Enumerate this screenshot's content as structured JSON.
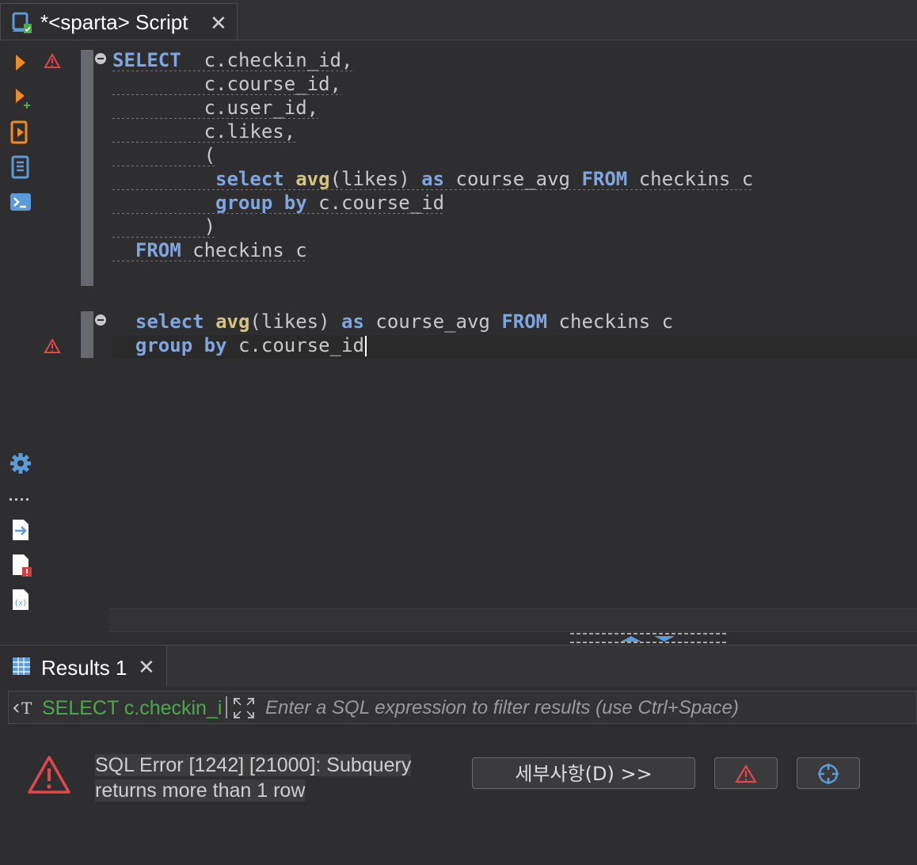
{
  "editor_tab": {
    "title": "*<sparta> Script",
    "close": "✕"
  },
  "code": {
    "block1": [
      [
        {
          "t": "SELECT",
          "c": "kw"
        },
        {
          "t": "  c.checkin_id,",
          "c": ""
        }
      ],
      [
        {
          "t": "        c.course_id,",
          "c": ""
        }
      ],
      [
        {
          "t": "        c.user_id,",
          "c": ""
        }
      ],
      [
        {
          "t": "        c.likes,",
          "c": ""
        }
      ],
      [
        {
          "t": "        (",
          "c": ""
        }
      ],
      [
        {
          "t": "         ",
          "c": ""
        },
        {
          "t": "select",
          "c": "kw"
        },
        {
          "t": " ",
          "c": ""
        },
        {
          "t": "avg",
          "c": "fn"
        },
        {
          "t": "(likes) ",
          "c": ""
        },
        {
          "t": "as",
          "c": "kw"
        },
        {
          "t": " course_avg ",
          "c": ""
        },
        {
          "t": "FROM",
          "c": "kw"
        },
        {
          "t": " checkins c",
          "c": ""
        }
      ],
      [
        {
          "t": "         ",
          "c": ""
        },
        {
          "t": "group",
          "c": "kw"
        },
        {
          "t": " ",
          "c": ""
        },
        {
          "t": "by",
          "c": "kw"
        },
        {
          "t": " c.course_id",
          "c": ""
        }
      ],
      [
        {
          "t": "        )",
          "c": ""
        }
      ],
      [
        {
          "t": "  ",
          "c": ""
        },
        {
          "t": "FROM",
          "c": "kw"
        },
        {
          "t": " checkins c",
          "c": ""
        }
      ]
    ],
    "block2": [
      [
        {
          "t": "  ",
          "c": ""
        },
        {
          "t": "select",
          "c": "kw"
        },
        {
          "t": " ",
          "c": ""
        },
        {
          "t": "avg",
          "c": "fn"
        },
        {
          "t": "(likes) ",
          "c": ""
        },
        {
          "t": "as",
          "c": "kw"
        },
        {
          "t": " course_avg ",
          "c": ""
        },
        {
          "t": "FROM",
          "c": "kw"
        },
        {
          "t": " checkins c",
          "c": ""
        }
      ],
      [
        {
          "t": "  ",
          "c": ""
        },
        {
          "t": "group",
          "c": "kw"
        },
        {
          "t": " ",
          "c": ""
        },
        {
          "t": "by",
          "c": "kw"
        },
        {
          "t": " c.course_id",
          "c": ""
        }
      ]
    ]
  },
  "results_tab": {
    "title": "Results 1",
    "close": "✕"
  },
  "filter": {
    "query": "SELECT c.checkin_id,",
    "placeholder": "Enter a SQL expression to filter results (use Ctrl+Space)"
  },
  "error": {
    "line1": "SQL Error [1242] [21000]: Subquery",
    "line2": "returns more than 1 row",
    "details_button": "세부사항(D) >>"
  },
  "colors": {
    "keyword": "#7ea6e0",
    "function": "#d3c581",
    "error_underline": "#e0407a",
    "filter_query": "#4caa4c",
    "warning": "#e0484a"
  },
  "icons": [
    "script-icon",
    "execute-statement-icon",
    "execute-in-new-tab-icon",
    "execute-script-icon",
    "explain-plan-icon",
    "console-icon",
    "settings-gear-icon",
    "more-icon",
    "export-icon",
    "problems-icon",
    "variables-icon",
    "warning-icon",
    "grid-icon",
    "maximize-icon",
    "error-icon",
    "crosshair-icon"
  ]
}
